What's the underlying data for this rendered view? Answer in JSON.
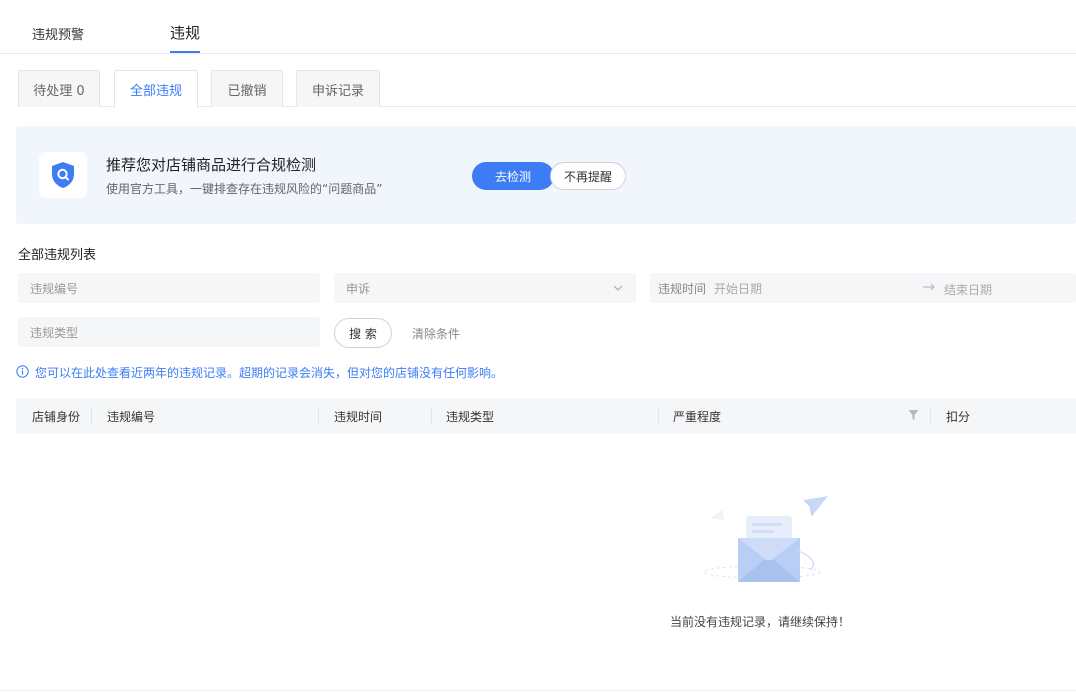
{
  "top_tabs": {
    "items": [
      {
        "label": "违规预警"
      },
      {
        "label": "违规"
      }
    ]
  },
  "sub_tabs": {
    "items": [
      {
        "label": "待处理 0"
      },
      {
        "label": "全部违规"
      },
      {
        "label": "已撤销"
      },
      {
        "label": "申诉记录"
      }
    ]
  },
  "banner": {
    "title": "推荐您对店铺商品进行合规检测",
    "desc": "使用官方工具，一键排查存在违规风险的“问题商品”",
    "check_label": "去检测",
    "dismiss_label": "不再提醒"
  },
  "section_title": "全部违规列表",
  "filters": {
    "code_placeholder": "违规编号",
    "appeal_placeholder": "申诉",
    "time_label": "违规时间",
    "start_placeholder": "开始日期",
    "end_placeholder": "结束日期",
    "type_placeholder": "违规类型",
    "search_label": "搜 索",
    "clear_label": "清除条件"
  },
  "notice": "您可以在此处查看近两年的违规记录。超期的记录会消失，但对您的店铺没有任何影响。",
  "table": {
    "columns": [
      "店铺身份",
      "违规编号",
      "违规时间",
      "违规类型",
      "严重程度",
      "扣分"
    ]
  },
  "empty_text": "当前没有违规记录，请继续保持！",
  "colors": {
    "accent": "#3c7cf5",
    "banner_bg": "#f1f5fc",
    "field_bg": "#f5f6f8"
  }
}
